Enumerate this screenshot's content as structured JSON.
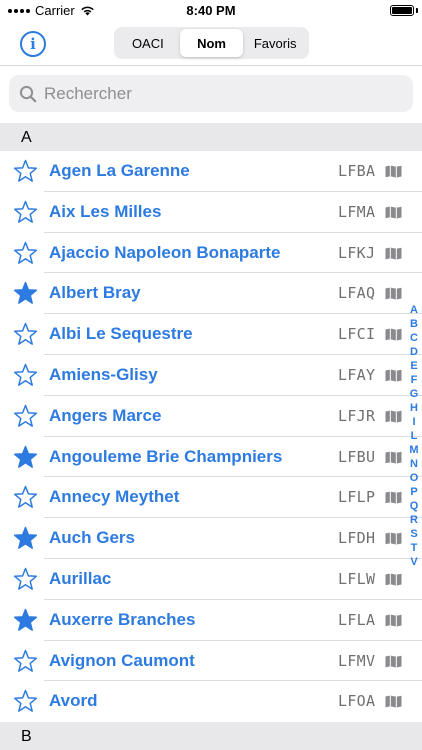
{
  "status_bar": {
    "carrier": "Carrier",
    "time": "8:40 PM"
  },
  "nav": {
    "info_label": "i",
    "segments": [
      {
        "label": "OACI",
        "active": false
      },
      {
        "label": "Nom",
        "active": true
      },
      {
        "label": "Favoris",
        "active": false
      }
    ]
  },
  "search": {
    "placeholder": "Rechercher",
    "value": ""
  },
  "sections": [
    {
      "letter": "A"
    },
    {
      "letter": "B"
    }
  ],
  "airfields": [
    {
      "name": "Agen La Garenne",
      "code": "LFBA",
      "favorite": false
    },
    {
      "name": "Aix Les Milles",
      "code": "LFMA",
      "favorite": false
    },
    {
      "name": "Ajaccio Napoleon Bonaparte",
      "code": "LFKJ",
      "favorite": false
    },
    {
      "name": "Albert Bray",
      "code": "LFAQ",
      "favorite": true
    },
    {
      "name": "Albi Le Sequestre",
      "code": "LFCI",
      "favorite": false
    },
    {
      "name": "Amiens-Glisy",
      "code": "LFAY",
      "favorite": false
    },
    {
      "name": "Angers Marce",
      "code": "LFJR",
      "favorite": false
    },
    {
      "name": "Angouleme Brie Champniers",
      "code": "LFBU",
      "favorite": true
    },
    {
      "name": "Annecy Meythet",
      "code": "LFLP",
      "favorite": false
    },
    {
      "name": "Auch Gers",
      "code": "LFDH",
      "favorite": true
    },
    {
      "name": "Aurillac",
      "code": "LFLW",
      "favorite": false
    },
    {
      "name": "Auxerre Branches",
      "code": "LFLA",
      "favorite": true
    },
    {
      "name": "Avignon Caumont",
      "code": "LFMV",
      "favorite": false
    },
    {
      "name": "Avord",
      "code": "LFOA",
      "favorite": false
    }
  ],
  "section_index": [
    "A",
    "B",
    "C",
    "D",
    "E",
    "F",
    "G",
    "H",
    "I",
    "L",
    "M",
    "N",
    "O",
    "P",
    "Q",
    "R",
    "S",
    "T",
    "V"
  ],
  "colors": {
    "accent": "#2d7be0",
    "code_text": "#707070",
    "section_bg": "#e8e8ea",
    "map_icon": "#8a8a8e"
  },
  "icons": {
    "info": "info-icon",
    "search": "search-icon",
    "favorite_on": "star-filled-icon",
    "favorite_off": "star-outline-icon",
    "chart": "map-icon"
  }
}
